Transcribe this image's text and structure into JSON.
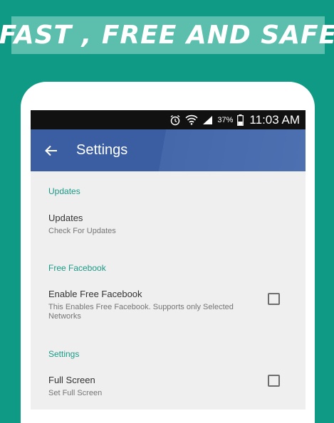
{
  "banner": {
    "text": "FAST , FREE AND SAFE"
  },
  "statusbar": {
    "battery": "37%",
    "time": "11:03 AM"
  },
  "appbar": {
    "title": "Settings"
  },
  "sections": [
    {
      "header": "Updates",
      "title": "Updates",
      "subtitle": "Check For Updates",
      "checkbox": false
    },
    {
      "header": "Free Facebook",
      "title": "Enable Free Facebook",
      "subtitle_line1": "This Enables Free Facebook. Supports only Selected",
      "subtitle_line2": "Networks",
      "checkbox": true,
      "checked": false
    },
    {
      "header": "Settings",
      "title": "Full Screen",
      "subtitle": "Set Full Screen",
      "checkbox": true,
      "checked": false
    }
  ],
  "colors": {
    "background": "#0e9a84",
    "appbar": "#3a5ea1",
    "accent": "#1a9a86"
  }
}
